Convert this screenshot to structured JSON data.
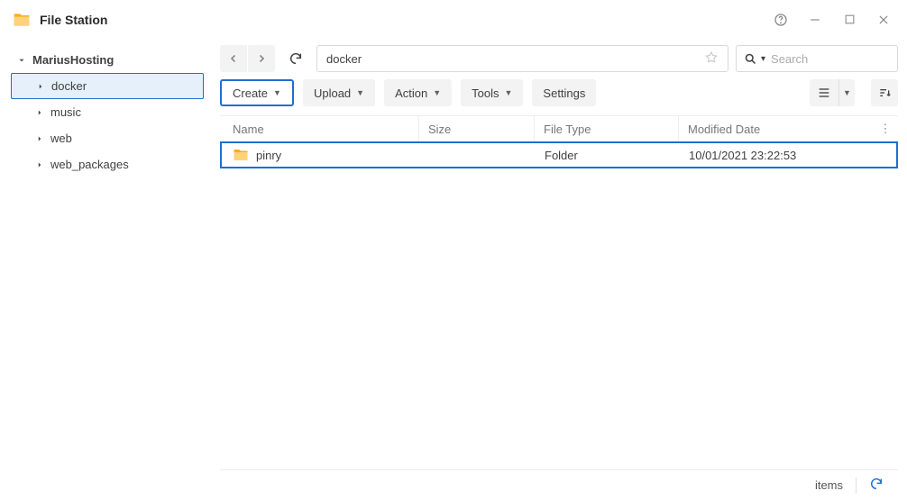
{
  "app": {
    "title": "File Station"
  },
  "sidebar": {
    "root": "MariusHosting",
    "items": [
      {
        "label": "docker",
        "selected": true
      },
      {
        "label": "music",
        "selected": false
      },
      {
        "label": "web",
        "selected": false
      },
      {
        "label": "web_packages",
        "selected": false
      }
    ]
  },
  "path": {
    "value": "docker"
  },
  "search": {
    "placeholder": "Search"
  },
  "toolbar": {
    "create": "Create",
    "upload": "Upload",
    "action": "Action",
    "tools": "Tools",
    "settings": "Settings"
  },
  "columns": {
    "name": "Name",
    "size": "Size",
    "type": "File Type",
    "date": "Modified Date"
  },
  "rows": [
    {
      "name": "pinry",
      "size": "",
      "type": "Folder",
      "date": "10/01/2021 23:22:53"
    }
  ],
  "status": {
    "items_label": "items"
  },
  "colors": {
    "accent": "#1f6fd0",
    "folder": "#fcae1e"
  }
}
